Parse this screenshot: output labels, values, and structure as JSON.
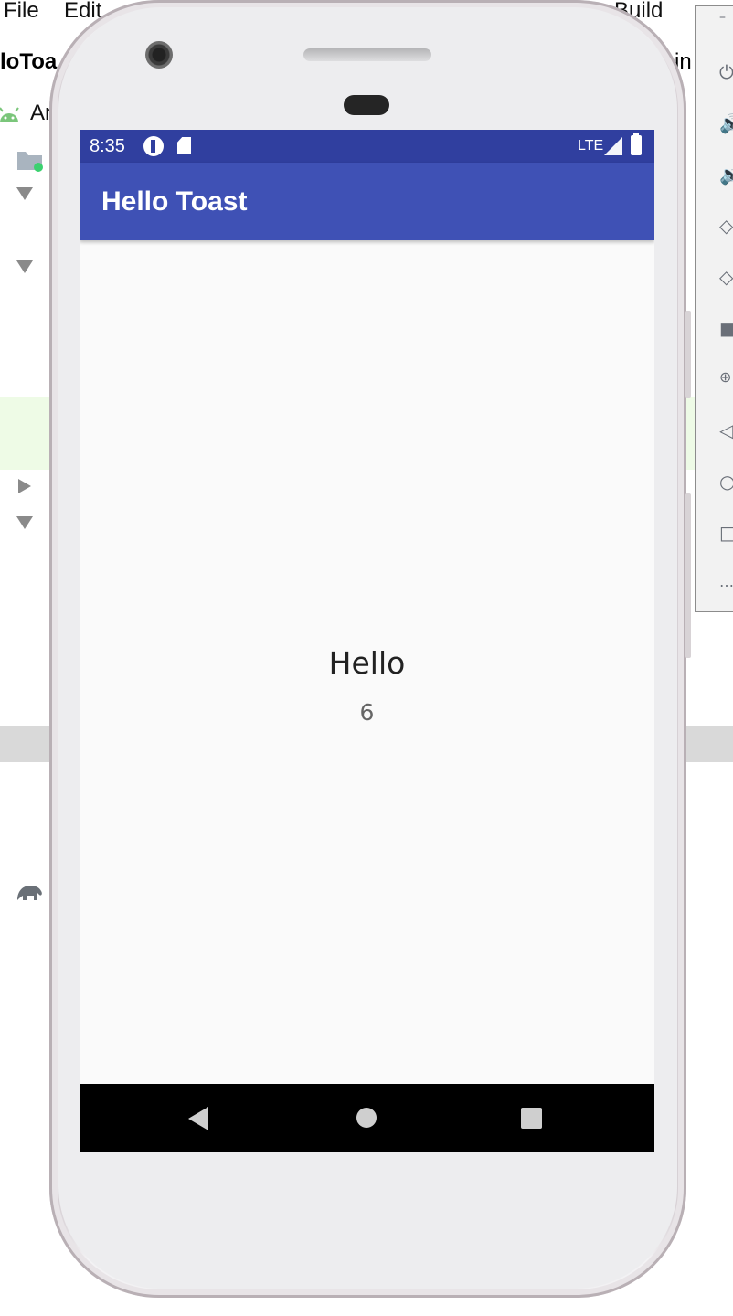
{
  "ide": {
    "menu": [
      "File",
      "Edit",
      "Build"
    ],
    "project_title": "loToa",
    "right_text": "in",
    "android_label": "Ar"
  },
  "emulator_toolbar": {
    "icons": [
      "power-icon",
      "volume-up-icon",
      "volume-down-icon",
      "rotate-left-icon",
      "rotate-right-icon",
      "camera-icon",
      "zoom-icon",
      "back-icon",
      "home-icon",
      "overview-icon",
      "more-icon"
    ]
  },
  "phone": {
    "status_bar": {
      "time": "8:35",
      "network": "LTE",
      "color": "#303f9f"
    },
    "app_bar": {
      "title": "Hello Toast",
      "color": "#3f51b5"
    },
    "content": {
      "greeting": "Hello",
      "count": "6"
    },
    "nav_bar": {
      "buttons": [
        "back",
        "home",
        "recents"
      ]
    }
  }
}
